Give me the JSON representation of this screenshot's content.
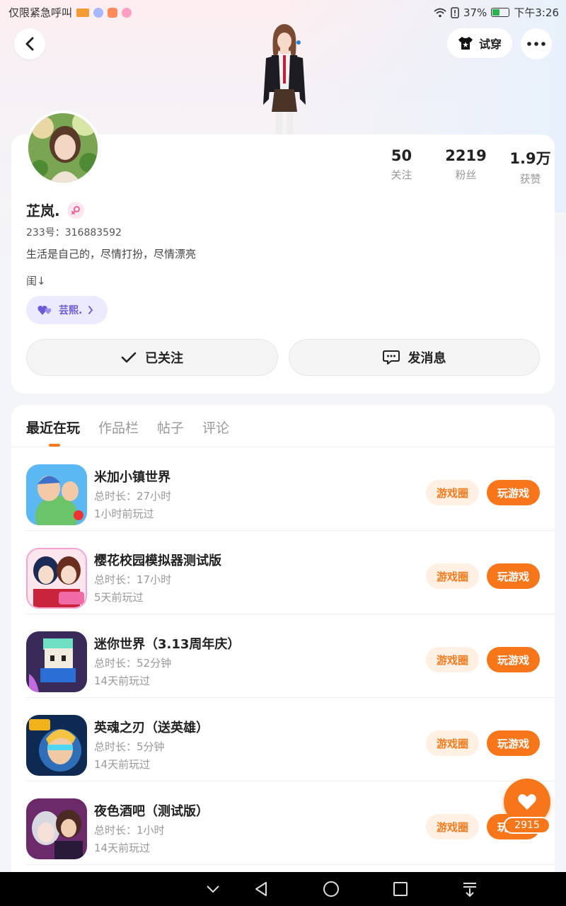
{
  "status_bar": {
    "left_text": "仅限紧急呼叫",
    "battery": "37%",
    "time": "下午3:26"
  },
  "header": {
    "try_on_label": "试穿"
  },
  "profile": {
    "stats": [
      {
        "num": "50",
        "label": "关注"
      },
      {
        "num": "2219",
        "label": "粉丝"
      },
      {
        "num": "1.9万",
        "label": "获赞"
      }
    ],
    "name": "芷岚.",
    "uid": "233号：316883592",
    "bio": "生活是自己的，尽情打扮，尽情漂亮",
    "extra": "闺↓",
    "cp_tag": "芸熙.",
    "follow_label": "已关注",
    "message_label": "发消息"
  },
  "tabs": [
    "最近在玩",
    "作品栏",
    "帖子",
    "评论"
  ],
  "games": [
    {
      "name": "米加小镇世界",
      "duration": "总时长：27小时",
      "last": "1小时前玩过"
    },
    {
      "name": "樱花校园模拟器测试版",
      "duration": "总时长：17小时",
      "last": "5天前玩过"
    },
    {
      "name": "迷你世界（3.13周年庆）",
      "duration": "总时长：52分钟",
      "last": "14天前玩过"
    },
    {
      "name": "英魂之刃（送英雄）",
      "duration": "总时长：5分钟",
      "last": "14天前玩过"
    },
    {
      "name": "夜色酒吧（测试版）",
      "duration": "总时长：1小时",
      "last": "14天前玩过"
    }
  ],
  "game_buttons": {
    "circle": "游戏圈",
    "play": "玩游戏"
  },
  "like_count": "2915",
  "colors": {
    "accent": "#f7761a",
    "accent_light": "#fff0e3",
    "cp_bg": "#eceaff"
  }
}
